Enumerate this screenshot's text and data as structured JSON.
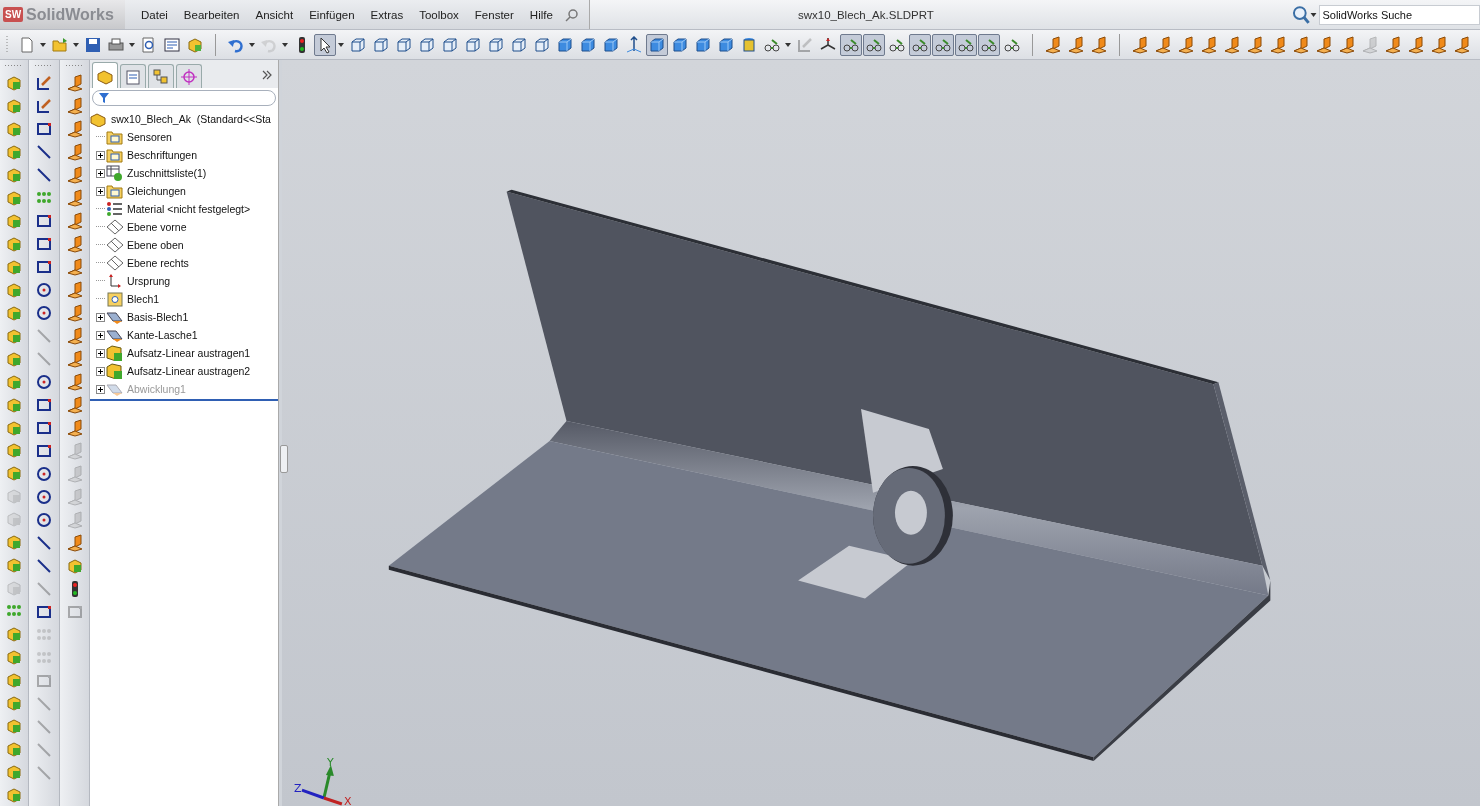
{
  "app": {
    "logo_mark": "SW",
    "logo": "SolidWorks"
  },
  "menu": [
    "Datei",
    "Bearbeiten",
    "Ansicht",
    "Einfügen",
    "Extras",
    "Toolbox",
    "Fenster",
    "Hilfe"
  ],
  "window": {
    "title": "swx10_Blech_Ak.SLDPRT"
  },
  "search": {
    "placeholder": "SolidWorks Suche"
  },
  "toolbar": [
    {
      "kind": "doc",
      "pressed": false,
      "disabled": false,
      "dropdown": true
    },
    {
      "kind": "folder",
      "pressed": false,
      "disabled": false,
      "dropdown": true
    },
    {
      "kind": "save",
      "pressed": false,
      "disabled": false,
      "dropdown": false
    },
    {
      "kind": "print",
      "pressed": false,
      "disabled": false,
      "dropdown": true
    },
    {
      "kind": "zoomdoc",
      "pressed": false,
      "disabled": false,
      "dropdown": false
    },
    {
      "kind": "props",
      "pressed": false,
      "disabled": false,
      "dropdown": false
    },
    {
      "kind": "feature",
      "pressed": false,
      "disabled": false,
      "dropdown": false
    },
    {
      "kind": "sep"
    },
    {
      "kind": "undo",
      "pressed": false,
      "disabled": false,
      "dropdown": true
    },
    {
      "kind": "redo",
      "pressed": false,
      "disabled": true,
      "dropdown": true
    },
    {
      "kind": "light",
      "pressed": false,
      "disabled": false,
      "dropdown": false
    },
    {
      "kind": "select",
      "pressed": true,
      "disabled": false,
      "dropdown": true
    },
    {
      "kind": "cube",
      "pressed": false,
      "disabled": false,
      "dropdown": false
    },
    {
      "kind": "cube",
      "pressed": false,
      "disabled": false,
      "dropdown": false
    },
    {
      "kind": "cube",
      "pressed": false,
      "disabled": false,
      "dropdown": false
    },
    {
      "kind": "cube",
      "pressed": false,
      "disabled": false,
      "dropdown": false
    },
    {
      "kind": "cube",
      "pressed": false,
      "disabled": false,
      "dropdown": false
    },
    {
      "kind": "cube",
      "pressed": false,
      "disabled": false,
      "dropdown": false
    },
    {
      "kind": "cube",
      "pressed": false,
      "disabled": false,
      "dropdown": false
    },
    {
      "kind": "cube",
      "pressed": false,
      "disabled": false,
      "dropdown": false
    },
    {
      "kind": "cube",
      "pressed": false,
      "disabled": false,
      "dropdown": false
    },
    {
      "kind": "solid",
      "pressed": false,
      "disabled": false,
      "dropdown": false
    },
    {
      "kind": "solid",
      "pressed": false,
      "disabled": false,
      "dropdown": false
    },
    {
      "kind": "solid",
      "pressed": false,
      "disabled": false,
      "dropdown": false
    },
    {
      "kind": "normal",
      "pressed": false,
      "disabled": false,
      "dropdown": false
    },
    {
      "kind": "solid",
      "pressed": true,
      "disabled": false,
      "dropdown": false
    },
    {
      "kind": "solid",
      "pressed": false,
      "disabled": false,
      "dropdown": false
    },
    {
      "kind": "solid",
      "pressed": false,
      "disabled": false,
      "dropdown": false
    },
    {
      "kind": "solid",
      "pressed": false,
      "disabled": false,
      "dropdown": false
    },
    {
      "kind": "section",
      "pressed": false,
      "disabled": false,
      "dropdown": false
    },
    {
      "kind": "glasses",
      "pressed": false,
      "disabled": false,
      "dropdown": true
    },
    {
      "kind": "sketch",
      "pressed": false,
      "disabled": true,
      "dropdown": false
    },
    {
      "kind": "triad",
      "pressed": false,
      "disabled": false,
      "dropdown": false
    },
    {
      "kind": "glasses",
      "pressed": true,
      "disabled": false,
      "dropdown": false
    },
    {
      "kind": "glasses",
      "pressed": true,
      "disabled": false,
      "dropdown": false
    },
    {
      "kind": "glasses",
      "pressed": false,
      "disabled": false,
      "dropdown": false
    },
    {
      "kind": "glasses",
      "pressed": true,
      "disabled": false,
      "dropdown": false
    },
    {
      "kind": "glasses",
      "pressed": true,
      "disabled": false,
      "dropdown": false
    },
    {
      "kind": "glasses",
      "pressed": true,
      "disabled": false,
      "dropdown": false
    },
    {
      "kind": "glasses",
      "pressed": true,
      "disabled": false,
      "dropdown": false
    },
    {
      "kind": "glasses",
      "pressed": false,
      "disabled": false,
      "dropdown": false
    },
    {
      "kind": "sep"
    },
    {
      "kind": "bent",
      "pressed": false,
      "disabled": false,
      "dropdown": false
    },
    {
      "kind": "bent",
      "pressed": false,
      "disabled": false,
      "dropdown": false
    },
    {
      "kind": "bent",
      "pressed": false,
      "disabled": false,
      "dropdown": false
    },
    {
      "kind": "sep"
    },
    {
      "kind": "bent",
      "pressed": false,
      "disabled": false,
      "dropdown": false
    },
    {
      "kind": "bent",
      "pressed": false,
      "disabled": false,
      "dropdown": false
    },
    {
      "kind": "bent",
      "pressed": false,
      "disabled": false,
      "dropdown": false
    },
    {
      "kind": "bent",
      "pressed": false,
      "disabled": false,
      "dropdown": false
    },
    {
      "kind": "bent",
      "pressed": false,
      "disabled": false,
      "dropdown": false
    },
    {
      "kind": "bent",
      "pressed": false,
      "disabled": false,
      "dropdown": false
    },
    {
      "kind": "bent",
      "pressed": false,
      "disabled": false,
      "dropdown": false
    },
    {
      "kind": "bent",
      "pressed": false,
      "disabled": false,
      "dropdown": false
    },
    {
      "kind": "bent",
      "pressed": false,
      "disabled": false,
      "dropdown": false
    },
    {
      "kind": "bent",
      "pressed": false,
      "disabled": false,
      "dropdown": false
    },
    {
      "kind": "bent",
      "pressed": false,
      "disabled": true,
      "dropdown": false
    },
    {
      "kind": "bent",
      "pressed": false,
      "disabled": false,
      "dropdown": false
    },
    {
      "kind": "bent",
      "pressed": false,
      "disabled": false,
      "dropdown": false
    },
    {
      "kind": "bent",
      "pressed": false,
      "disabled": false,
      "dropdown": false
    },
    {
      "kind": "bent",
      "pressed": false,
      "disabled": false,
      "dropdown": false
    }
  ],
  "left_toolbars": [
    [
      {
        "kind": "feature",
        "disabled": false
      },
      {
        "kind": "feature",
        "disabled": false
      },
      {
        "kind": "feature",
        "disabled": false
      },
      {
        "kind": "feature",
        "disabled": false
      },
      {
        "kind": "feature",
        "disabled": false
      },
      {
        "kind": "feature",
        "disabled": false
      },
      {
        "kind": "feature",
        "disabled": false
      },
      {
        "kind": "feature",
        "disabled": false
      },
      {
        "kind": "feature",
        "disabled": false
      },
      {
        "kind": "feature",
        "disabled": false
      },
      {
        "kind": "feature",
        "disabled": false
      },
      {
        "kind": "feature",
        "disabled": false
      },
      {
        "kind": "feature",
        "disabled": false
      },
      {
        "kind": "feature",
        "disabled": false
      },
      {
        "kind": "feature",
        "disabled": false
      },
      {
        "kind": "feature",
        "disabled": false
      },
      {
        "kind": "feature",
        "disabled": false
      },
      {
        "kind": "feature",
        "disabled": false
      },
      {
        "kind": "feature",
        "disabled": true
      },
      {
        "kind": "feature",
        "disabled": true
      },
      {
        "kind": "feature",
        "disabled": false
      },
      {
        "kind": "feature",
        "disabled": false
      },
      {
        "kind": "feature",
        "disabled": true
      },
      {
        "kind": "dots",
        "disabled": false
      },
      {
        "kind": "feature",
        "disabled": false
      },
      {
        "kind": "feature",
        "disabled": false
      },
      {
        "kind": "feature",
        "disabled": false
      },
      {
        "kind": "feature",
        "disabled": false
      },
      {
        "kind": "feature",
        "disabled": false
      },
      {
        "kind": "feature",
        "disabled": false
      },
      {
        "kind": "feature",
        "disabled": false
      },
      {
        "kind": "feature",
        "disabled": false
      }
    ],
    [
      {
        "kind": "sketch",
        "disabled": false
      },
      {
        "kind": "sketch",
        "disabled": false
      },
      {
        "kind": "rect",
        "disabled": false
      },
      {
        "kind": "line",
        "disabled": false
      },
      {
        "kind": "line",
        "disabled": false
      },
      {
        "kind": "dots",
        "disabled": false
      },
      {
        "kind": "rect",
        "disabled": false
      },
      {
        "kind": "rect",
        "disabled": false
      },
      {
        "kind": "rect",
        "disabled": false
      },
      {
        "kind": "circle",
        "disabled": false
      },
      {
        "kind": "circle",
        "disabled": false
      },
      {
        "kind": "line",
        "disabled": true
      },
      {
        "kind": "line",
        "disabled": true
      },
      {
        "kind": "circle",
        "disabled": false
      },
      {
        "kind": "rect",
        "disabled": false
      },
      {
        "kind": "rect",
        "disabled": false
      },
      {
        "kind": "rect",
        "disabled": false
      },
      {
        "kind": "circle",
        "disabled": false
      },
      {
        "kind": "circle",
        "disabled": false
      },
      {
        "kind": "circle",
        "disabled": false
      },
      {
        "kind": "line",
        "disabled": false
      },
      {
        "kind": "line",
        "disabled": false
      },
      {
        "kind": "line",
        "disabled": true
      },
      {
        "kind": "rect",
        "disabled": false
      },
      {
        "kind": "dots",
        "disabled": true
      },
      {
        "kind": "dots",
        "disabled": true
      },
      {
        "kind": "rect",
        "disabled": true
      },
      {
        "kind": "line",
        "disabled": true
      },
      {
        "kind": "line",
        "disabled": true
      },
      {
        "kind": "line",
        "disabled": true
      },
      {
        "kind": "line",
        "disabled": true
      }
    ],
    [
      {
        "kind": "bent",
        "disabled": false
      },
      {
        "kind": "bent",
        "disabled": false
      },
      {
        "kind": "bent",
        "disabled": false
      },
      {
        "kind": "bent",
        "disabled": false
      },
      {
        "kind": "bent",
        "disabled": false
      },
      {
        "kind": "bent",
        "disabled": false
      },
      {
        "kind": "bent",
        "disabled": false
      },
      {
        "kind": "bent",
        "disabled": false
      },
      {
        "kind": "bent",
        "disabled": false
      },
      {
        "kind": "bent",
        "disabled": false
      },
      {
        "kind": "bent",
        "disabled": false
      },
      {
        "kind": "bent",
        "disabled": false
      },
      {
        "kind": "bent",
        "disabled": false
      },
      {
        "kind": "bent",
        "disabled": false
      },
      {
        "kind": "bent",
        "disabled": false
      },
      {
        "kind": "bent",
        "disabled": false
      },
      {
        "kind": "bent",
        "disabled": true
      },
      {
        "kind": "bent",
        "disabled": true
      },
      {
        "kind": "bent",
        "disabled": true
      },
      {
        "kind": "bent",
        "disabled": true
      },
      {
        "kind": "bent",
        "disabled": false
      },
      {
        "kind": "feature",
        "disabled": false
      },
      {
        "kind": "light",
        "disabled": false
      },
      {
        "kind": "rect",
        "disabled": true
      }
    ]
  ],
  "panel_tabs": [
    {
      "kind": "part",
      "selected": true
    },
    {
      "kind": "props",
      "selected": false
    },
    {
      "kind": "config",
      "selected": false
    },
    {
      "kind": "target",
      "selected": false
    }
  ],
  "tree": {
    "label": "swx10_Blech_Ak  (Standard<<Sta",
    "children": [
      {
        "label": "Sensoren",
        "kind": "folder",
        "expandable": false,
        "disabled": false
      },
      {
        "label": "Beschriftungen",
        "kind": "folder",
        "expandable": true,
        "disabled": false
      },
      {
        "label": "Zuschnittsliste(1)",
        "kind": "table",
        "expandable": true,
        "disabled": false
      },
      {
        "label": "Gleichungen",
        "kind": "folder",
        "expandable": true,
        "disabled": false
      },
      {
        "label": "Material <nicht festgelegt>",
        "kind": "material",
        "expandable": false,
        "disabled": false
      },
      {
        "label": "Ebene vorne",
        "kind": "plane",
        "expandable": false,
        "disabled": false
      },
      {
        "label": "Ebene oben",
        "kind": "plane",
        "expandable": false,
        "disabled": false
      },
      {
        "label": "Ebene rechts",
        "kind": "plane",
        "expandable": false,
        "disabled": false
      },
      {
        "label": "Ursprung",
        "kind": "origin",
        "expandable": false,
        "disabled": false
      },
      {
        "label": "Blech1",
        "kind": "sheet",
        "expandable": false,
        "disabled": false
      },
      {
        "label": "Basis-Blech1",
        "kind": "bent",
        "expandable": true,
        "disabled": false
      },
      {
        "label": "Kante-Lasche1",
        "kind": "bent",
        "expandable": true,
        "disabled": false
      },
      {
        "label": "Aufsatz-Linear austragen1",
        "kind": "feature",
        "expandable": true,
        "disabled": false
      },
      {
        "label": "Aufsatz-Linear austragen2",
        "kind": "feature",
        "expandable": true,
        "disabled": false
      },
      {
        "label": "Abwicklung1",
        "kind": "bent",
        "expandable": true,
        "disabled": true
      }
    ]
  },
  "triad": {
    "x": "X",
    "y": "Y",
    "z": "Z"
  }
}
